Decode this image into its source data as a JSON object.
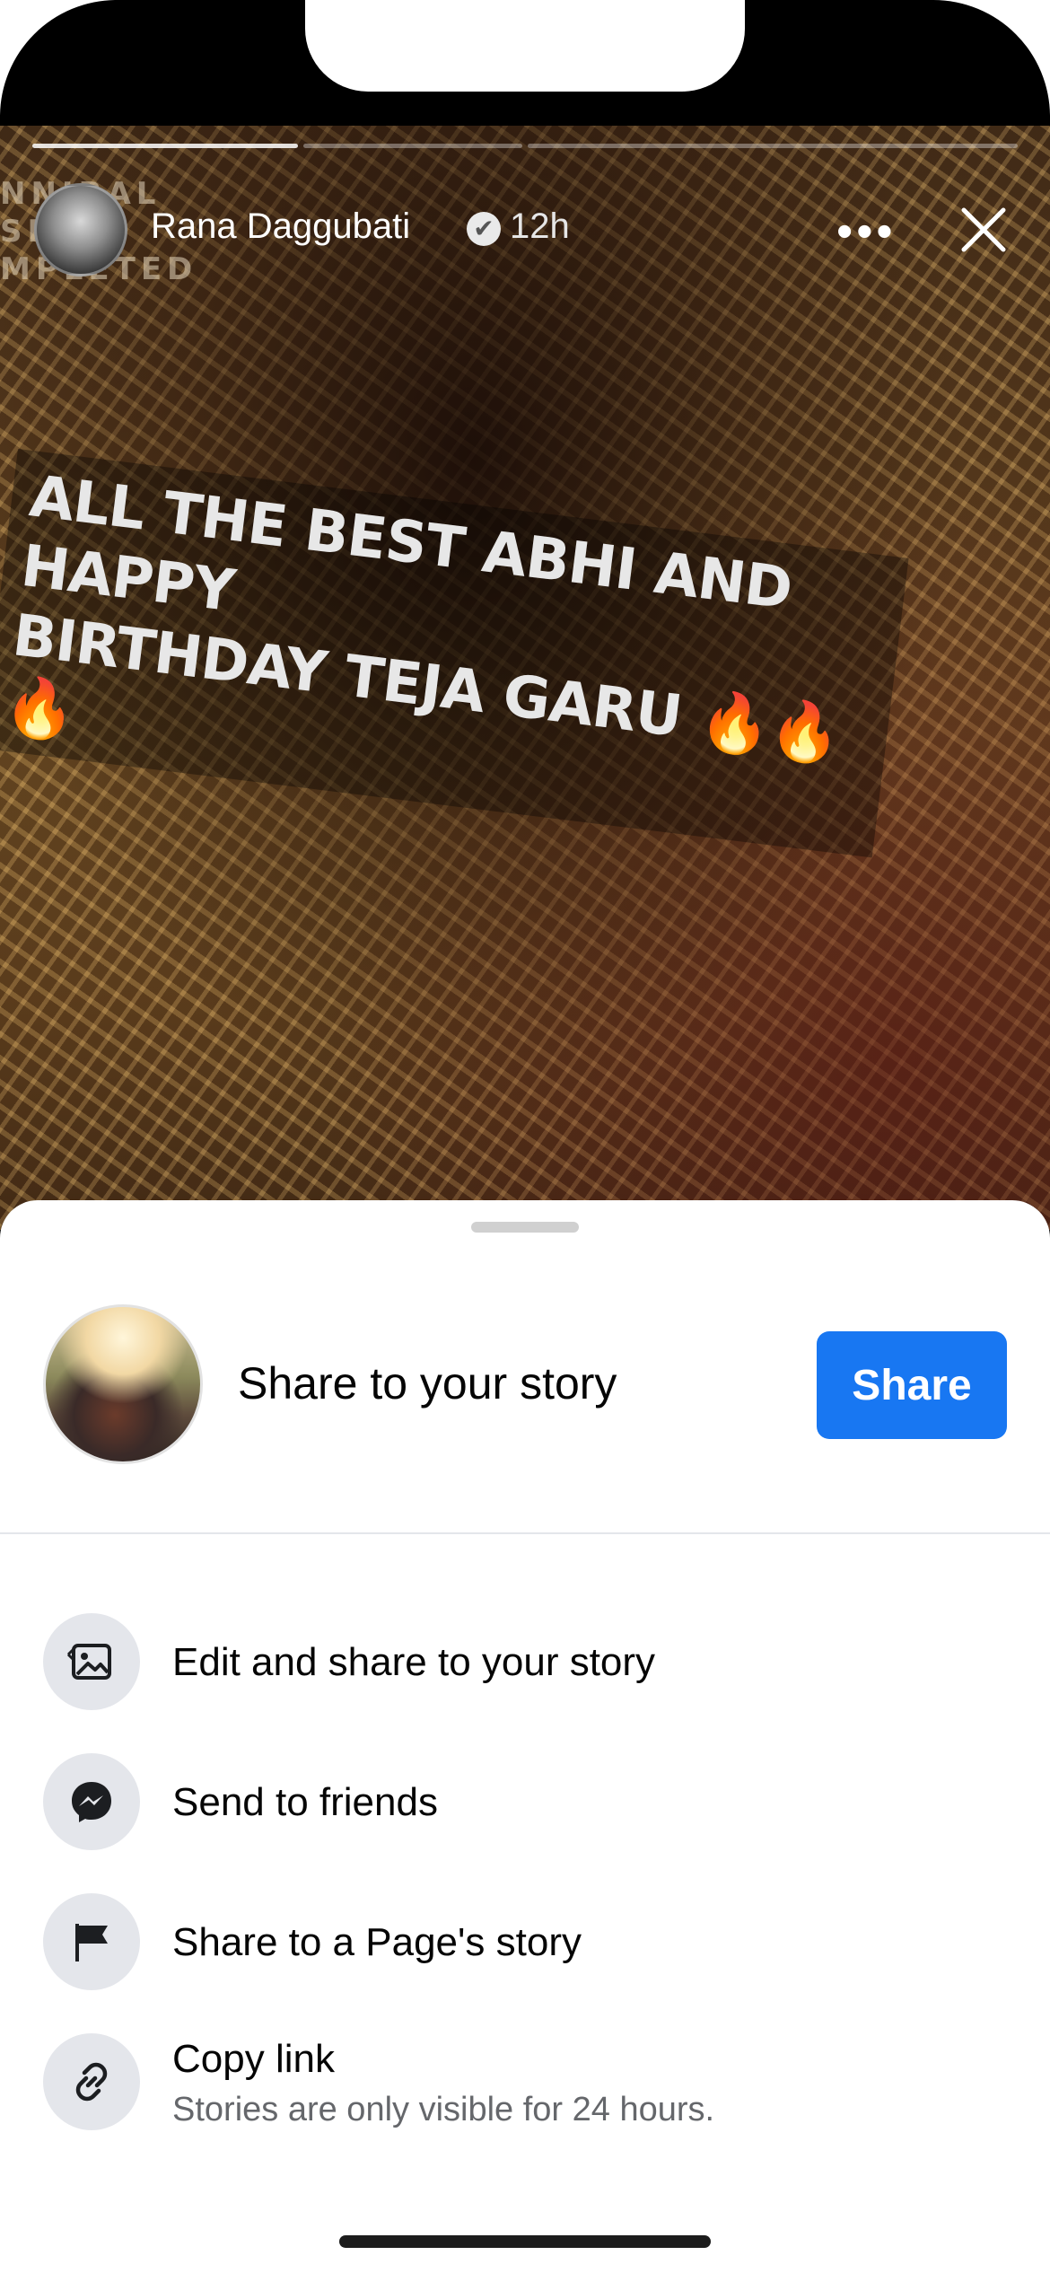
{
  "story": {
    "side_text": [
      "NNIBAL",
      "SH",
      "MPLETED"
    ],
    "user_name": "Rana Daggubati",
    "verified_mark": "✔",
    "time_ago": "12h",
    "more_icon": "•••",
    "caption_line1": "ALL THE BEST ABHI  AND HAPPY",
    "caption_line2": "BIRTHDAY TEJA GARU",
    "caption_emojis": "🔥🔥🔥"
  },
  "sheet": {
    "share_story_label": "Share to your story",
    "share_button": "Share",
    "options": [
      {
        "label": "Edit and share to your story",
        "icon": "edit-story-icon"
      },
      {
        "label": "Send to friends",
        "icon": "messenger-icon"
      },
      {
        "label": "Share to a Page's story",
        "icon": "flag-icon"
      },
      {
        "label": "Copy link",
        "sublabel": "Stories are only visible for 24 hours.",
        "icon": "link-icon"
      }
    ]
  },
  "colors": {
    "accent": "#1877f2",
    "icon_bg": "#e4e6eb",
    "secondary_text": "#65676b"
  }
}
